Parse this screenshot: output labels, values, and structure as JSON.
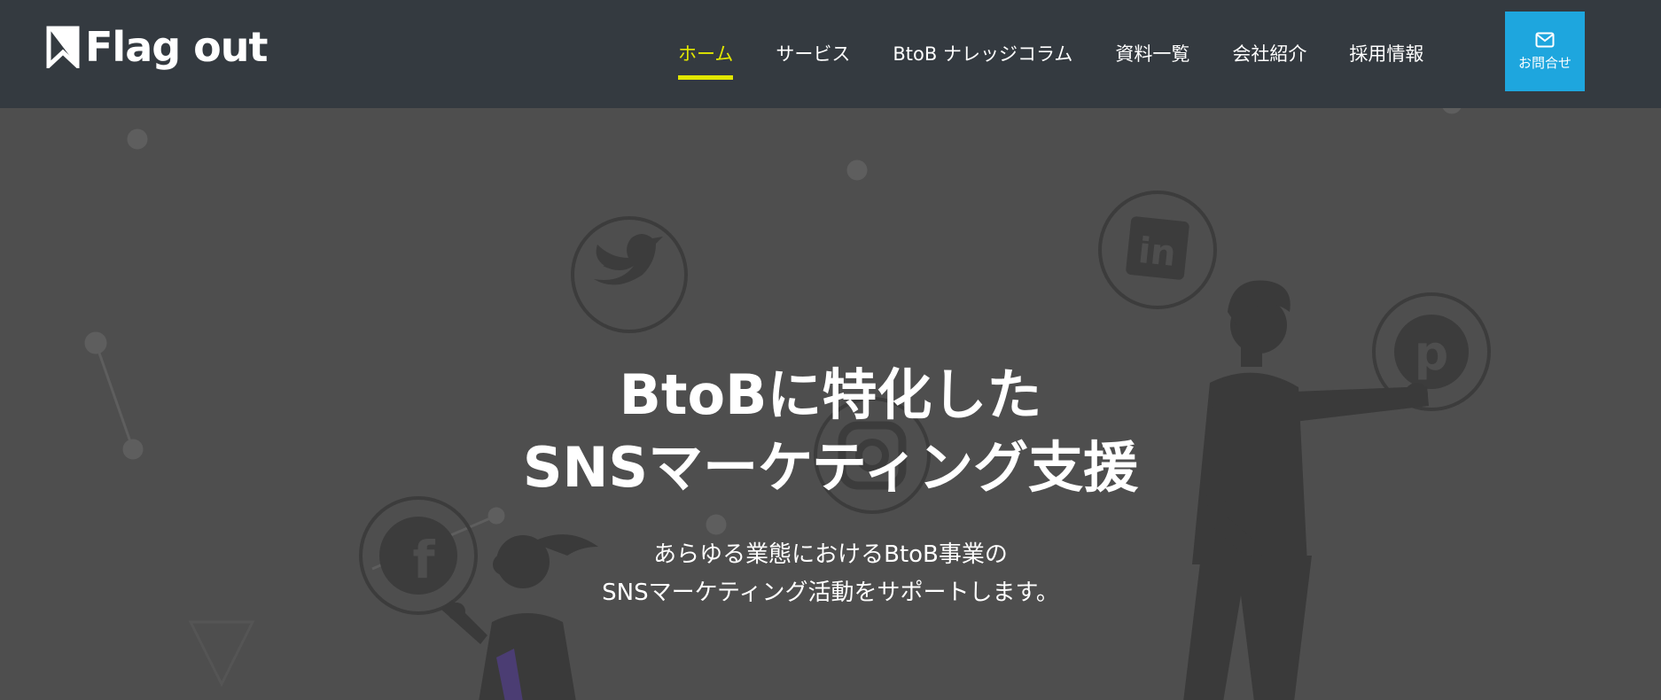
{
  "header": {
    "logo_text": "Flag out",
    "nav": [
      {
        "label": "ホーム",
        "active": true
      },
      {
        "label": "サービス",
        "active": false
      },
      {
        "label": "BtoB ナレッジコラム",
        "active": false
      },
      {
        "label": "資料一覧",
        "active": false
      },
      {
        "label": "会社紹介",
        "active": false
      },
      {
        "label": "採用情報",
        "active": false
      }
    ],
    "contact_label": "お問合せ"
  },
  "hero": {
    "title_line1": "BtoBに特化した",
    "title_line2": "SNSマーケティング支援",
    "sub_line1": "あらゆる業態におけるBtoB事業の",
    "sub_line2": "SNSマーケティング活動をサポートします。"
  },
  "colors": {
    "header_bg": "#343a40",
    "accent_active": "#e1e600",
    "contact_bg": "#1ea6de",
    "hero_bg": "#4e4e4e"
  }
}
